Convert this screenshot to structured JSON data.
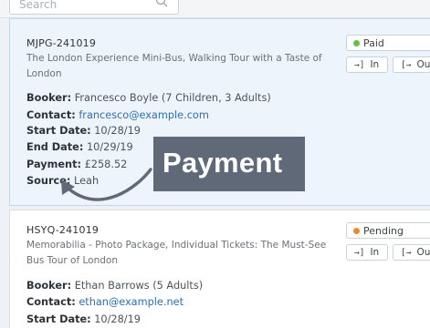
{
  "search": {
    "placeholder": "Search"
  },
  "bookings": [
    {
      "ref": "MJPG-241019",
      "title": "The London Experience Mini-Bus, Walking Tour with a Taste of London",
      "booker_label": "Booker:",
      "booker": "Francesco Boyle (7 Children, 3 Adults)",
      "contact_label": "Contact:",
      "contact": "francesco@example.com",
      "start_label": "Start Date:",
      "start": "10/28/19",
      "end_label": "End Date:",
      "end": "10/29/19",
      "payment_label": "Payment:",
      "payment": "£258.52",
      "source_label": "Source:",
      "source": "Leah",
      "status": "Paid",
      "status_color": "#6bbf3f",
      "in_label": "In",
      "out_label": "Out"
    },
    {
      "ref": "HSYQ-241019",
      "title": "Memorabilia - Photo Package, Individual Tickets: The Must-See Bus Tour of London",
      "booker_label": "Booker:",
      "booker": "Ethan Barrows (5 Adults)",
      "contact_label": "Contact:",
      "contact": "ethan@example.net",
      "start_label": "Start Date:",
      "start": "10/28/19",
      "status": "Pending",
      "status_color": "#ef8a2a",
      "in_label": "In",
      "out_label": "Out"
    }
  ],
  "callout": {
    "text": "Payment"
  },
  "icons": {
    "check_in": "arrow-into-bracket-icon",
    "check_out": "bracket-arrow-out-icon",
    "search": "search-icon"
  }
}
